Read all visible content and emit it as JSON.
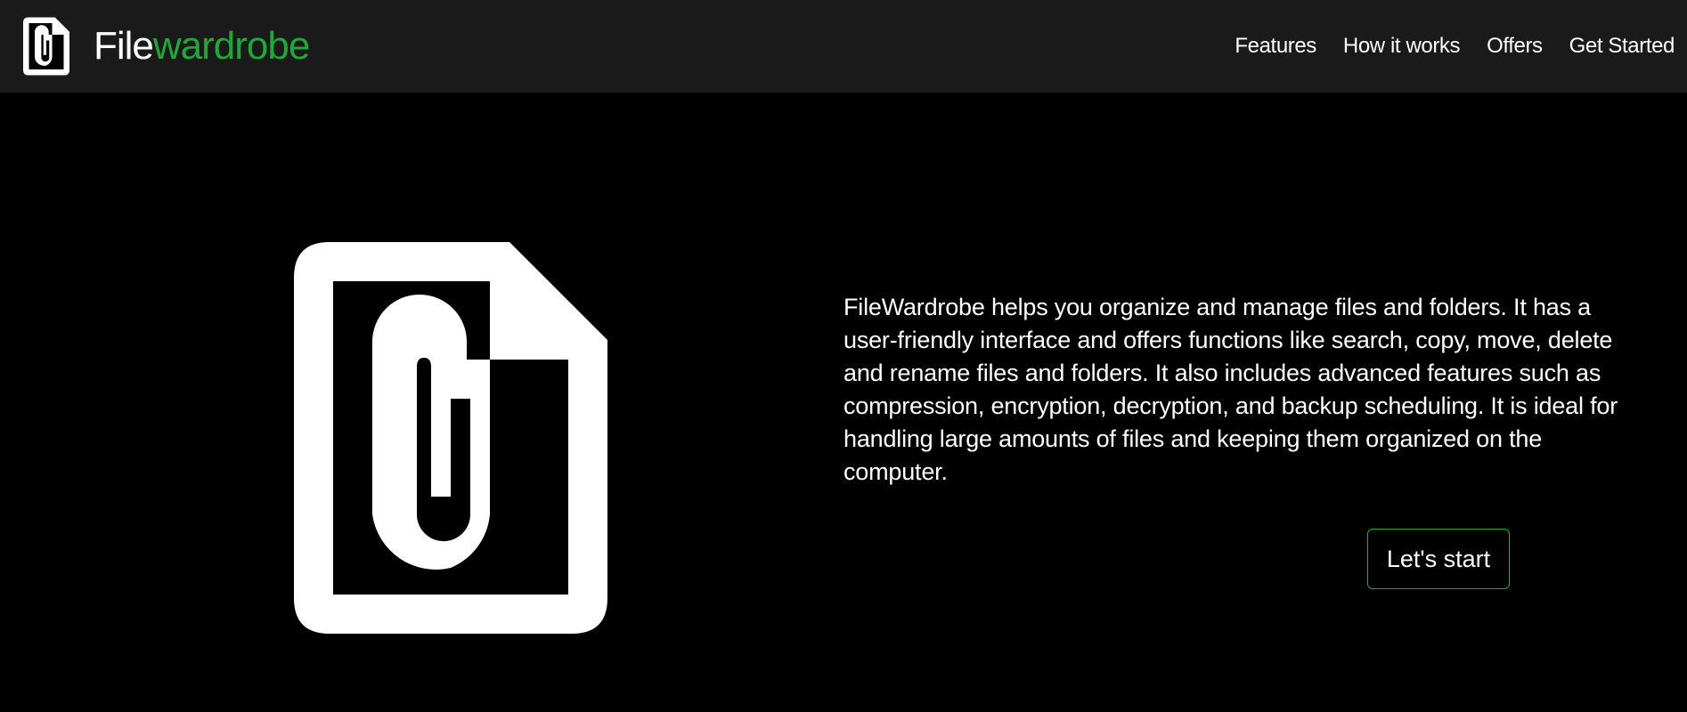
{
  "header": {
    "logo_icon": "paperclip-document-icon",
    "brand_part_1": "File",
    "brand_part_2": "wardrobe",
    "nav": [
      {
        "label": "Features"
      },
      {
        "label": "How it works"
      },
      {
        "label": "Offers"
      },
      {
        "label": "Get Started"
      }
    ]
  },
  "hero": {
    "illustration": "paperclip-document-icon",
    "description": "FileWardrobe helps you organize and manage files and folders. It has a user-friendly interface and offers functions like search, copy, move, delete and rename files and folders. It also includes advanced features such as compression, encryption, decryption, and backup scheduling. It is ideal for handling large amounts of files and keeping them organized on the computer.",
    "cta_label": "Let's start"
  },
  "colors": {
    "page_background": "#000000",
    "header_background": "#1b1a1a",
    "accent_green": "#1fa83a",
    "text": "#ffffff"
  }
}
